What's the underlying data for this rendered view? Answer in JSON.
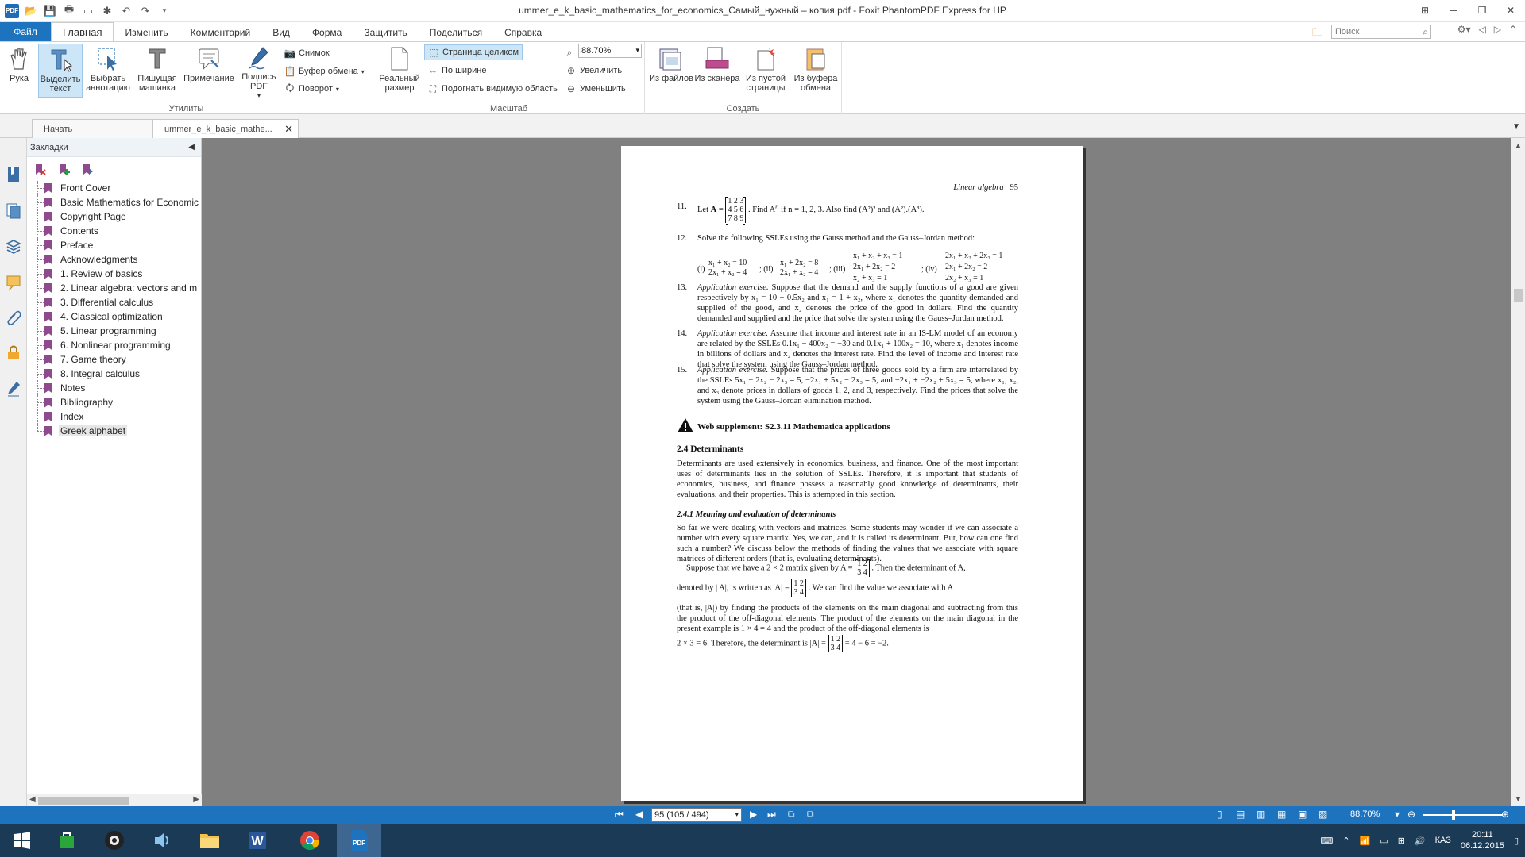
{
  "window": {
    "title": "ummer_e_k_basic_mathematics_for_economics_Самый_нужный – копия.pdf - Foxit PhantomPDF Express for HP"
  },
  "menu": {
    "file": "Файл",
    "tabs": [
      "Главная",
      "Изменить",
      "Комментарий",
      "Вид",
      "Форма",
      "Защитить",
      "Поделиться",
      "Справка"
    ],
    "search_placeholder": "Поиск"
  },
  "ribbon": {
    "hand": "Рука",
    "select_text": "Выделить текст",
    "select_annot": "Выбрать аннотацию",
    "typewriter": "Пишущая машинка",
    "note": "Примечание",
    "sign_pdf": "Подпись PDF",
    "snapshot": "Снимок",
    "clipboard": "Буфер обмена",
    "rotate": "Поворот",
    "group_utils": "Утилиты",
    "actual_size": "Реальный размер",
    "full_page": "Страница целиком",
    "fit_width": "По ширине",
    "fit_visible": "Подогнать видимую область",
    "zoom_value": "88.70%",
    "zoom_in": "Увеличить",
    "zoom_out": "Уменьшить",
    "group_zoom": "Масштаб",
    "from_files": "Из файлов",
    "from_scanner": "Из сканера",
    "from_blank": "Из пустой страницы",
    "from_clipboard": "Из буфера обмена",
    "group_create": "Создать"
  },
  "doctabs": {
    "start": "Начать",
    "current": "ummer_e_k_basic_mathe..."
  },
  "bookmarks": {
    "title": "Закладки",
    "items": [
      "Front Cover",
      "Basic Mathematics for Economic",
      "Copyright Page",
      "Contents",
      "Preface",
      "Acknowledgments",
      "1. Review of basics",
      "2. Linear algebra: vectors and m",
      "3. Differential calculus",
      "4. Classical optimization",
      "5. Linear programming",
      "6. Nonlinear programming",
      "7. Game theory",
      "8. Integral calculus",
      "Notes",
      "Bibliography",
      "Index",
      "Greek alphabet"
    ]
  },
  "page": {
    "header": "Linear algebra",
    "page_no": "95",
    "ex11_num": "11.",
    "ex11_a": "Let ",
    "ex11_b": ". Find A",
    "ex11_c": " if n = 1, 2, 3. Also find (A²)² and (A²).(A³).",
    "ex11_matrix": [
      "1 2 3",
      "4 5 6",
      "7 8 9"
    ],
    "ex12_num": "12.",
    "ex12_text": "Solve the following SSLEs using the Gauss method and the Gauss–Jordan method:",
    "ex13_num": "13.",
    "ex13_lead": "Application exercise.",
    "ex13_text": " Suppose that the demand and the supply functions of a good are given respectively by x₁ = 10 − 0.5x₂ and x₁ = 1 + x₂, where x₁ denotes the quantity demanded and supplied of the good, and x₂ denotes the price of the good in dollars. Find the quantity demanded and supplied and the price that solve the system using the Gauss–Jordan method.",
    "ex14_num": "14.",
    "ex14_lead": "Application exercise.",
    "ex14_text": " Assume that income and interest rate in an IS-LM model of an economy are related by the SSLEs 0.1x₁ − 400x₂ = −30 and 0.1x₁ + 100x₂ = 10, where x₁ denotes income in billions of dollars and x₂ denotes the interest rate. Find the level of income and interest rate that solve the system using the Gauss–Jordan method.",
    "ex15_num": "15.",
    "ex15_lead": "Application exercise.",
    "ex15_text": " Suppose that the prices of three goods sold by a firm are interrelated by the SSLEs 5x₁ − 2x₂ − 2x₃ = 5, −2x₁ + 5x₂ − 2x₃ = 5, and −2x₁ + −2x₂ + 5x₃ = 5, where x₁, x₂, and x₃ denote prices in dollars of goods 1, 2, and 3, respectively. Find the prices that solve the system using the Gauss–Jordan elimination method.",
    "web_supplement": "Web supplement: S2.3.11 Mathematica applications",
    "sec24": "2.4 Determinants",
    "sec24_text": "Determinants are used extensively in economics, business, and finance. One of the most important uses of determinants lies in the solution of SSLEs. Therefore, it is important that students of economics, business, and finance possess a reasonably good knowledge of determinants, their evaluations, and their properties. This is attempted in this section.",
    "sub241": "2.4.1 Meaning and evaluation of determinants",
    "sub241_text": "So far we were dealing with vectors and matrices. Some students may wonder if we can associate a number with every square matrix. Yes, we can, and it is called its determinant. But, how can one find such a number? We discuss below the methods of finding the values that we associate with square matrices of different orders (that is, evaluating determinants).",
    "p_suppose_a": "Suppose that we have a 2 × 2 matrix given by A = ",
    "p_suppose_b": ". Then the determinant of A,",
    "p_denoted_a": "denoted by | A|, is written as |A| = ",
    "p_denoted_b": ". We can find the value we associate with A",
    "p_rest": "(that is, |A|) by finding the products of the elements on the main diagonal and subtracting from this the product of the off-diagonal elements. The product of the elements on the main diagonal in the present example is 1 × 4 = 4 and the product of the off-diagonal elements is",
    "p_final_a": "2 × 3 = 6. Therefore, the determinant is |A| = ",
    "p_final_b": " = 4 − 6 = −2.",
    "mat2": [
      "1 2",
      "3 4"
    ]
  },
  "status": {
    "page": "95 (105 / 494)",
    "zoom": "88.70%"
  },
  "taskbar": {
    "lang": "КАЗ",
    "time": "20:11",
    "date": "06.12.2015"
  }
}
